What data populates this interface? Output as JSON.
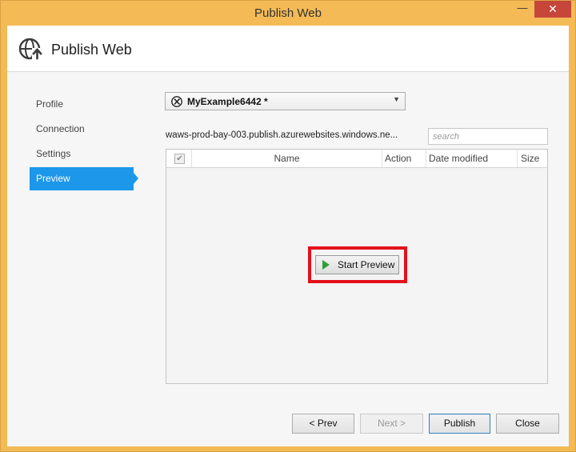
{
  "window": {
    "title": "Publish Web",
    "minimize_glyph": "—",
    "close_glyph": "✕"
  },
  "header": {
    "title": "Publish Web",
    "icon": "globe-upload-icon"
  },
  "nav": {
    "items": [
      {
        "label": "Profile",
        "active": false
      },
      {
        "label": "Connection",
        "active": false
      },
      {
        "label": "Settings",
        "active": false
      },
      {
        "label": "Preview",
        "active": true
      }
    ]
  },
  "profile": {
    "selected": "MyExample6442 *",
    "icon": "azure-website-icon"
  },
  "server_url": "waws-prod-bay-003.publish.azurewebsites.windows.ne...",
  "search": {
    "placeholder": "search",
    "value": ""
  },
  "grid": {
    "columns": {
      "name": "Name",
      "action": "Action",
      "date_modified": "Date modified",
      "size": "Size"
    },
    "select_all_glyph": "✔",
    "rows": []
  },
  "start_preview": {
    "label": "Start Preview",
    "icon": "play-icon",
    "play_color": "#2e9e38",
    "highlight_color": "#e4101b"
  },
  "buttons": {
    "prev": "< Prev",
    "next": "Next >",
    "publish": "Publish",
    "close": "Close"
  },
  "colors": {
    "accent": "#1c97ea",
    "window_frame": "#f3ba56",
    "close_button": "#c7463a"
  }
}
